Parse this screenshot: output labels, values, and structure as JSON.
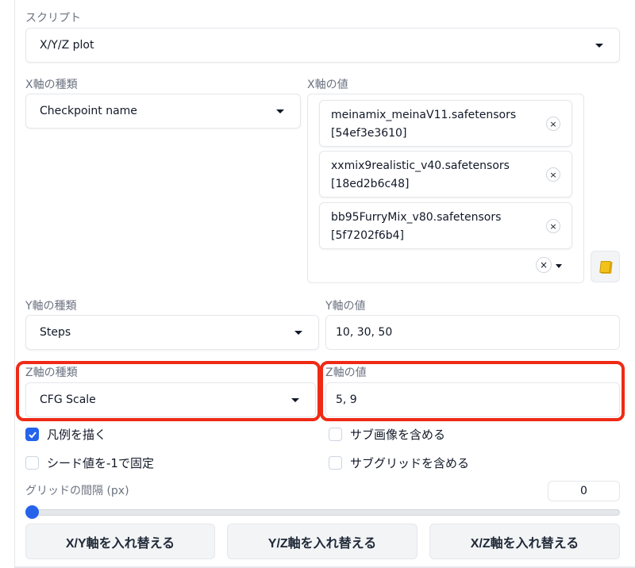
{
  "script": {
    "label": "スクリプト",
    "selected": "X/Y/Z plot"
  },
  "x_axis": {
    "type_label": "X軸の種類",
    "type_value": "Checkpoint name",
    "values_label": "X軸の値",
    "tokens": [
      {
        "line1": "meinamix_meinaV11.safetensors",
        "line2": "[54ef3e3610]"
      },
      {
        "line1": "xxmix9realistic_v40.safetensors",
        "line2": "[18ed2b6c48]"
      },
      {
        "line1": "bb95FurryMix_v80.safetensors",
        "line2": "[5f7202f6b4]"
      }
    ]
  },
  "y_axis": {
    "type_label": "Y軸の種類",
    "type_value": "Steps",
    "values_label": "Y軸の値",
    "values": "10, 30, 50"
  },
  "z_axis": {
    "type_label": "Z軸の種類",
    "type_value": "CFG Scale",
    "values_label": "Z軸の値",
    "values": "5, 9"
  },
  "options": {
    "draw_legend": {
      "label": "凡例を描く",
      "checked": true
    },
    "include_sub_images": {
      "label": "サブ画像を含める",
      "checked": false
    },
    "keep_seed": {
      "label": "シード値を-1で固定",
      "checked": false
    },
    "include_sub_grids": {
      "label": "サブグリッドを含める",
      "checked": false
    }
  },
  "grid_margin": {
    "label": "グリッドの間隔 (px)",
    "value": "0"
  },
  "buttons": {
    "swap_xy": "X/Y軸を入れ替える",
    "swap_yz": "Y/Z軸を入れ替える",
    "swap_xz": "X/Z軸を入れ替える"
  },
  "colors": {
    "highlight": "#ef2a16",
    "accent": "#2563eb"
  },
  "icons": {
    "clear": "×",
    "folder": "folder-icon"
  }
}
